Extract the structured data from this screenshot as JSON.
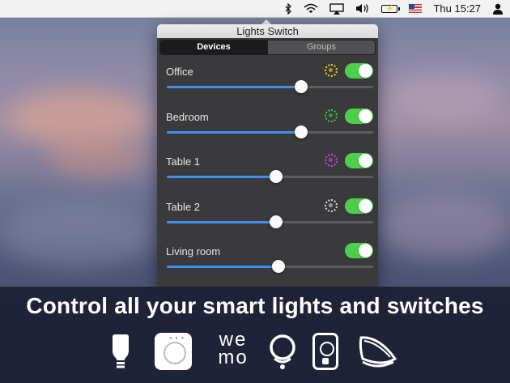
{
  "menubar": {
    "clock": "Thu 15:27",
    "icons": [
      "lights-switch-app-icon",
      "bluetooth-icon",
      "wifi-icon",
      "airplay-icon",
      "volume-icon",
      "battery-charging-icon",
      "us-flag-icon",
      "user-icon"
    ]
  },
  "popover": {
    "title": "Lights Switch",
    "tabs": [
      {
        "label": "Devices",
        "active": true
      },
      {
        "label": "Groups",
        "active": false
      }
    ],
    "devices": [
      {
        "name": "Office",
        "color": "#f2d21b",
        "on": true,
        "brightness": 0.65
      },
      {
        "name": "Bedroom",
        "color": "#3ccf3c",
        "on": true,
        "brightness": 0.65
      },
      {
        "name": "Table 1",
        "color": "#e040e6",
        "on": true,
        "brightness": 0.53
      },
      {
        "name": "Table 2",
        "color": "#d9d9d9",
        "on": true,
        "brightness": 0.53
      },
      {
        "name": "Living room",
        "color": null,
        "on": true,
        "brightness": 0.54
      }
    ]
  },
  "banner": {
    "tagline": "Control all your smart lights and switches",
    "logos": [
      "hue-bulb-icon",
      "hue-bridge-icon",
      "wemo-logo",
      "lifx-logo",
      "smart-plug-icon",
      "lamp-icon"
    ],
    "wemo_text": [
      "we",
      "mo"
    ]
  }
}
